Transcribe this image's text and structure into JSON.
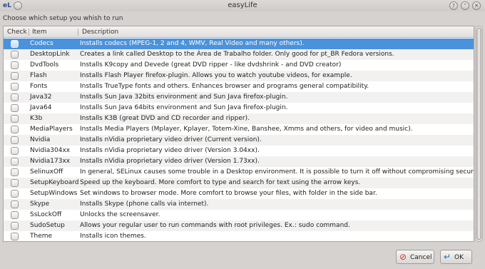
{
  "window": {
    "title": "easyLife",
    "app_icon_text": "eL",
    "buttons": [
      "help-icon",
      "minimize-icon",
      "close-icon"
    ]
  },
  "instruction": "Choose which setup you whish to run",
  "table": {
    "headers": {
      "check": "Check",
      "item": "Item",
      "description": "Description"
    },
    "selected_index": 0,
    "rows": [
      {
        "item": "Codecs",
        "description": "Installs codecs (MPEG-1, 2 and 4, WMV, Real Video and many others)."
      },
      {
        "item": "DesktopLink",
        "description": "Creates a link called Desktop to the Área de Trabalho folder. Only good for pt_BR Fedora versions."
      },
      {
        "item": "DvdTools",
        "description": "Installs K9copy and Devede (great DVD ripper - like dvdshrink - and DVD creator)"
      },
      {
        "item": "Flash",
        "description": "Installs Flash Player firefox-plugin. Allows you to watch youtube videos, for example."
      },
      {
        "item": "Fonts",
        "description": "Installs TrueType fonts and others. Enhances browser and programs general compatibility."
      },
      {
        "item": "Java32",
        "description": "Installs Sun Java 32bits environment and Sun Java firefox-plugin."
      },
      {
        "item": "Java64",
        "description": "Installs Sun Java 64bits environment and Sun Java firefox-plugin."
      },
      {
        "item": "K3b",
        "description": "Installs K3B (great DVD and CD recorder and ripper)."
      },
      {
        "item": "MediaPlayers",
        "description": "Installs Media Players (Mplayer, Kplayer, Totem-Xine, Banshee, Xmms and others, for video and music)."
      },
      {
        "item": "Nvidia",
        "description": "Installs nVidia proprietary video driver (Current version)."
      },
      {
        "item": "Nvidia304xx",
        "description": "Installs nVidia proprietary video driver (Version 3.04xx)."
      },
      {
        "item": "Nvidia173xx",
        "description": "Installs nVidia proprietary video driver (Version 1.73xx)."
      },
      {
        "item": "SelinuxOff",
        "description": "In general, SELinux causes some trouble in a Desktop environment. It is possible to turn it off without compromising security."
      },
      {
        "item": "SetupKeyboard",
        "description": "Speed up the keyboard. More comfort to type and search for text using the arrow keys."
      },
      {
        "item": "SetupWindows",
        "description": "Set windows to browser mode. More comfort to browse your files, with folder in the side bar."
      },
      {
        "item": "Skype",
        "description": "Installs Skype (phone calls via internet)."
      },
      {
        "item": "SsLockOff",
        "description": "Unlocks the screensaver."
      },
      {
        "item": "SudoSetup",
        "description": "Allows your regular user to run commands with root privileges. Ex.: sudo command."
      },
      {
        "item": "Theme",
        "description": "Installs icon themes."
      }
    ]
  },
  "footer": {
    "cancel_label": "Cancel",
    "ok_label": "OK"
  },
  "colors": {
    "selection": "#4a92db",
    "window_bg": "#d6d2d0"
  }
}
